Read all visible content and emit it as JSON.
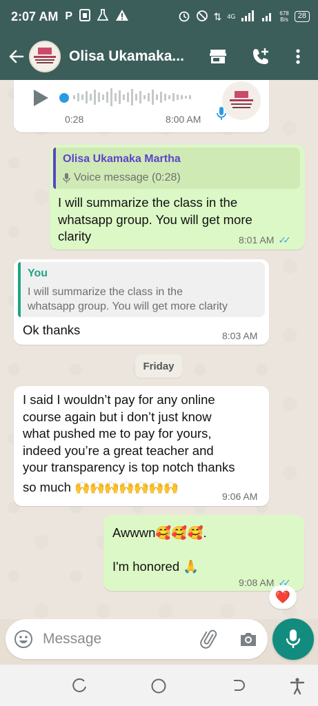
{
  "status_bar": {
    "time": "2:07 AM",
    "left_icons": [
      "parking-p-icon",
      "sim-icon",
      "flask-icon",
      "warning-icon"
    ],
    "net_speed_value": "678",
    "net_speed_unit": "B/s",
    "network": "4G",
    "battery": "28"
  },
  "header": {
    "contact_name": "Olisa Ukamaka...",
    "icons": [
      "back-arrow-icon",
      "avatar",
      "store-icon",
      "add-call-icon",
      "more-vert-icon"
    ]
  },
  "messages": {
    "voice_note": {
      "duration": "0:28",
      "time": "8:00 AM"
    },
    "msg2": {
      "quote_name": "Olisa Ukamaka Martha",
      "quote_text": "Voice message (0:28)",
      "line1": "I will summarize the class in the",
      "line2": "whatsapp group. You will get more",
      "line3": "clarity",
      "time": "8:01 AM"
    },
    "msg3": {
      "quote_name": "You",
      "quote_line1": "I will summarize the class in the",
      "quote_line2": "whatsapp group. You will get more clarity",
      "text": "Ok thanks",
      "time": "8:03 AM"
    },
    "date_divider": "Friday",
    "msg4": {
      "line1": "I said I wouldn’t pay for any online",
      "line2": "course again but i don’t just know",
      "line3": "what pushed me to pay for yours,",
      "line4": "indeed you’re a great teacher and",
      "line5": "your transparency is top notch thanks",
      "line6": "so much",
      "emojis": "🙌🙌🙌🙌🙌🙌🙌",
      "time": "9:06 AM"
    },
    "msg5": {
      "line1_text": "Awwwn",
      "line1_emojis": "🥰🥰🥰",
      "line1_end": ".",
      "line2_text": "I'm honored",
      "line2_emoji": "🙏",
      "time": "9:08 AM",
      "reaction": "❤️"
    }
  },
  "composer": {
    "placeholder": "Message"
  },
  "colors": {
    "header_bg": "#3b5e5a",
    "outgoing_bubble": "#dcf8c6",
    "incoming_bubble": "#ffffff",
    "mic_button": "#128c7e",
    "ticks": "#4fa3e0"
  }
}
